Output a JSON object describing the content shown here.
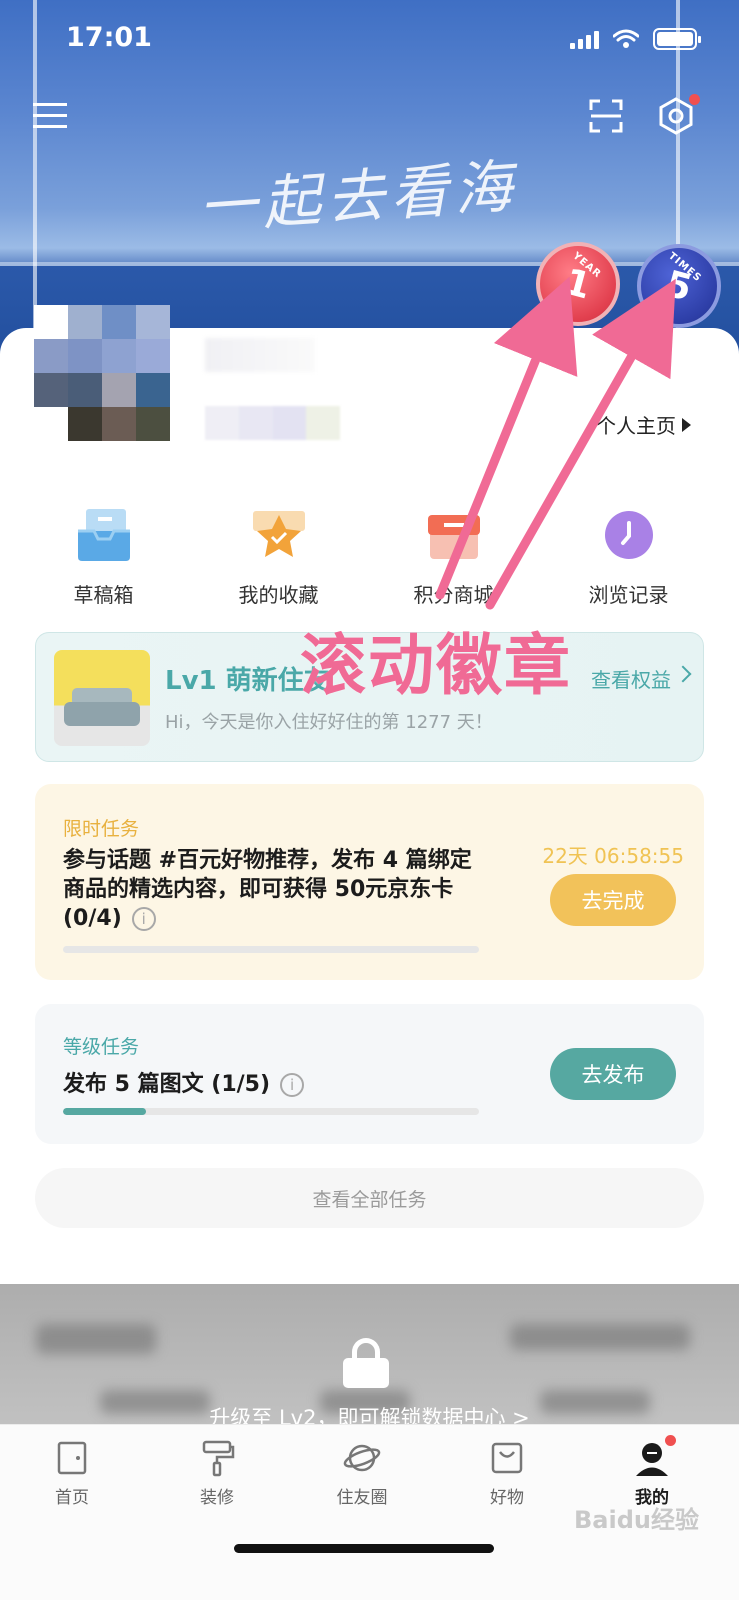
{
  "status_bar": {
    "time": "17:01"
  },
  "header": {
    "slogan": "一起去看海"
  },
  "badges": [
    {
      "number": "1",
      "caption": "YEAR",
      "color": "#e2404f"
    },
    {
      "number": "5",
      "caption": "TIMES",
      "color": "#2e3fa8"
    }
  ],
  "profile": {
    "homepage_label": "个人主页"
  },
  "shortcuts": [
    {
      "label": "草稿箱",
      "icon": "draft-box-icon"
    },
    {
      "label": "我的收藏",
      "icon": "star-favorites-icon"
    },
    {
      "label": "积分商城",
      "icon": "shop-icon"
    },
    {
      "label": "浏览记录",
      "icon": "clock-history-icon"
    }
  ],
  "level": {
    "title": "Lv1 萌新住友",
    "subtitle": "Hi，今天是你入住好好住的第 1277 天！",
    "link": "查看权益"
  },
  "limited_task": {
    "tag": "限时任务",
    "description": "参与话题 #百元好物推荐，发布 4 篇绑定商品的精选内容，即可获得 50元京东卡 (0/4)",
    "countdown": "22天 06:58:55",
    "button": "去完成",
    "progress": 0
  },
  "level_task": {
    "tag": "等级任务",
    "description": "发布 5 篇图文 (1/5)",
    "button": "去发布",
    "progress": 0.2
  },
  "all_tasks_label": "查看全部任务",
  "locked": {
    "text": "升级至 Lv2，即可解锁数据中心 >"
  },
  "tabbar": [
    {
      "label": "首页",
      "icon": "home-icon"
    },
    {
      "label": "装修",
      "icon": "paint-roller-icon"
    },
    {
      "label": "住友圈",
      "icon": "planet-icon"
    },
    {
      "label": "好物",
      "icon": "shopping-bag-icon"
    },
    {
      "label": "我的",
      "icon": "user-avatar-icon"
    }
  ],
  "annotation": {
    "text": "滚动徽章"
  },
  "watermark": "Baidu经验",
  "colors": {
    "accent_teal": "#4aa8a8",
    "limited_yellow": "#f2c25a",
    "annotation_pink": "#f06a95",
    "notification_red": "#f05050"
  }
}
